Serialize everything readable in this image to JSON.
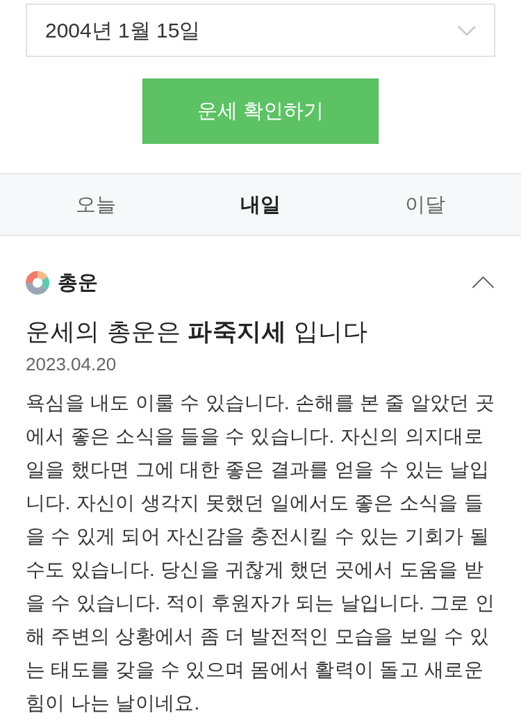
{
  "date_select": {
    "value": "2004년 1월 15일"
  },
  "check_button": {
    "label": "운세 확인하기"
  },
  "tabs": [
    {
      "label": "오늘",
      "selected": false
    },
    {
      "label": "내일",
      "selected": true
    },
    {
      "label": "이달",
      "selected": false
    }
  ],
  "section": {
    "title": "총운",
    "expanded": true,
    "headline": "운세의 총운은 **파죽지세** 입니다",
    "date": "2023.04.20",
    "body": "욕심을 내도 이룰 수 있습니다. 손해를 본 줄 알았던 곳에서 좋은 소식을 들을 수 있습니다. 자신의 의지대로 일을 했다면 그에 대한 좋은 결과를 얻을 수 있는 날입니다. 자신이 생각지 못했던 일에서도 좋은 소식을 들을 수 있게 되어 자신감을 충전시킬 수 있는 기회가 될 수도 있습니다. 당신을 귀찮게 했던 곳에서 도움을 받을 수 있습니다. 적이 후원자가 되는 날입니다. 그로 인해 주변의 상황에서 좀 더 발전적인 모습을 보일 수 있는 태도를 갖을 수 있으며 몸에서 활력이 돌고 새로운 힘이 나는 날이네요."
  }
}
